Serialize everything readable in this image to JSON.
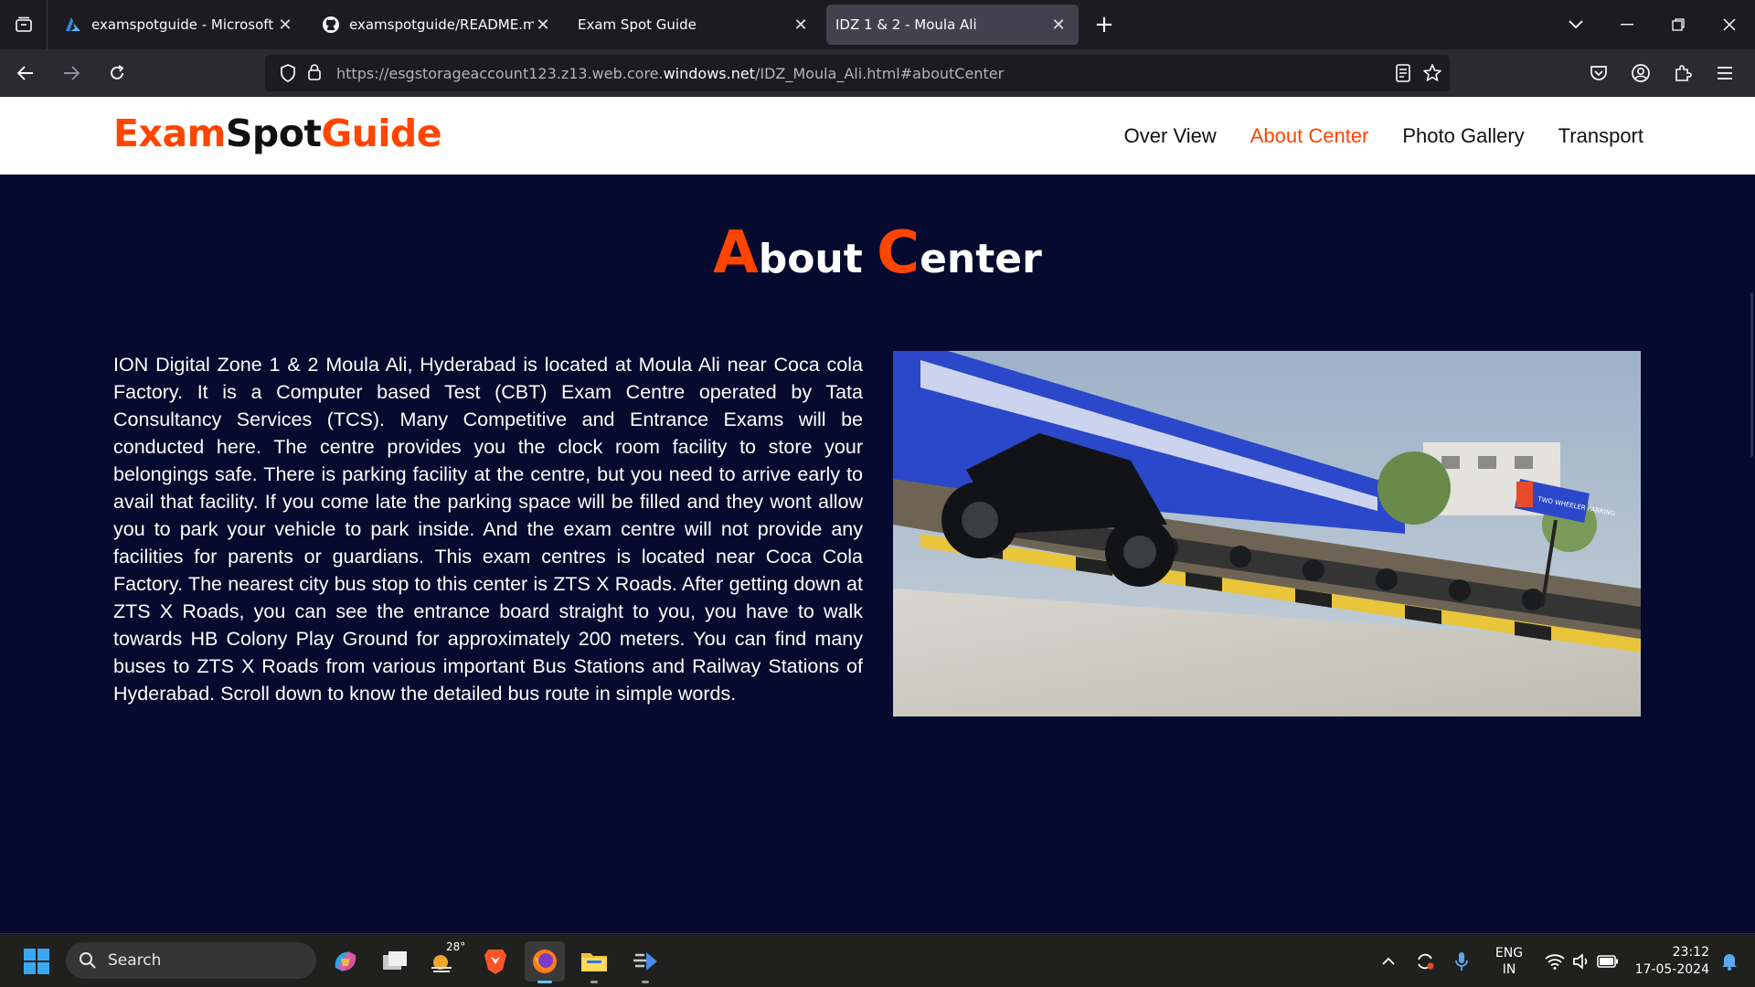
{
  "browser": {
    "tabs": [
      {
        "title": "examspotguide - Microsoft Azure",
        "icon": "azure-icon",
        "active": false
      },
      {
        "title": "examspotguide/README.md at main",
        "icon": "github-icon",
        "active": false
      },
      {
        "title": "Exam Spot Guide",
        "icon": "",
        "active": false
      },
      {
        "title": "IDZ 1 & 2 - Moula Ali",
        "icon": "",
        "active": true
      }
    ],
    "url_prefix": "https://esgstorageaccount123.z13.web.core.",
    "url_host": "windows.net",
    "url_suffix": "/IDZ_Moula_Ali.html#aboutCenter"
  },
  "site": {
    "logo_part1": "Exam",
    "logo_part2": "Spot",
    "logo_part3": "Guide",
    "nav": [
      {
        "label": "Over View",
        "active": false
      },
      {
        "label": "About Center",
        "active": true
      },
      {
        "label": "Photo Gallery",
        "active": false
      },
      {
        "label": "Transport",
        "active": false
      }
    ],
    "accent_color": "#ff4500",
    "background_color": "#050a2e"
  },
  "about": {
    "title_cap1": "A",
    "title_rest1": "bout ",
    "title_cap2": "C",
    "title_rest2": "enter",
    "body": "ION Digital Zone 1 & 2 Moula Ali, Hyderabad is located at Moula Ali near Coca cola Factory. It is a Computer based Test (CBT) Exam Centre operated by Tata Consultancy Services (TCS). Many Competitive and Entrance Exams will be conducted here. The centre provides you the clock room facility to store your belongings safe. There is parking facility at the centre, but you need to arrive early to avail that facility. If you come late the parking space will be filled and they wont allow you to park your vehicle to park inside. And the exam centre will not provide any facilities for parents or guardians. This exam centres is located near Coca Cola Factory. The nearest city bus stop to this center is ZTS X Roads. After getting down at ZTS X Roads, you can see the entrance board straight to you, you have to walk towards HB Colony Play Ground for approximately 200 meters. You can find many buses to ZTS X Roads from various important Bus Stations and Railway Stations of Hyderabad. Scroll down to know the detailed bus route in simple words.",
    "image_sign_text": "TWO WHEELER PARKING"
  },
  "taskbar": {
    "search_label": "Search",
    "weather_temp": "28°",
    "lang_line1": "ENG",
    "lang_line2": "IN",
    "time": "23:12",
    "date": "17-05-2024"
  }
}
